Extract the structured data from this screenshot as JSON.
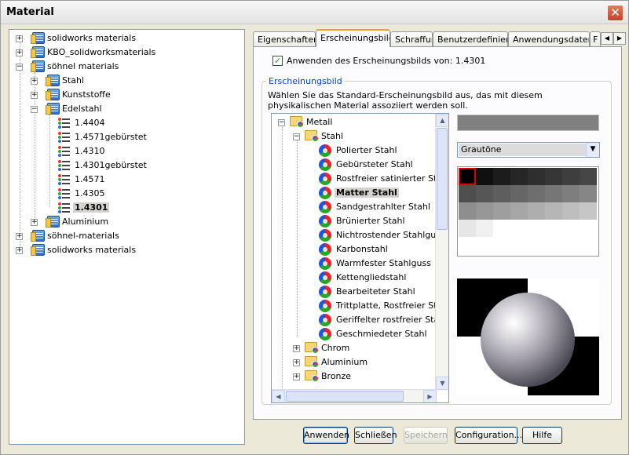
{
  "window": {
    "title": "Material",
    "close_glyph": "✕"
  },
  "material_tree": {
    "roots": [
      {
        "label": "solidworks materials",
        "expanded": false
      },
      {
        "label": "KBO_solidworksmaterials",
        "expanded": false
      },
      {
        "label": "söhnel materials",
        "expanded": true
      },
      {
        "label": "söhnel-materials",
        "expanded": false
      },
      {
        "label": "solidworks materials",
        "expanded": false
      }
    ],
    "sohnel_children": [
      "Stahl",
      "Kunststoffe",
      "Edelstahl",
      "Aluminium"
    ],
    "edelstahl_items": [
      "1.4404",
      "1.4571gebürstet",
      "1.4310",
      "1.4301gebürstet",
      "1.4571",
      "1.4305",
      "1.4301"
    ],
    "selected": "1.4301"
  },
  "tabs": [
    "Eigenschaften",
    "Erscheinungsbild",
    "Schraffur",
    "Benutzerdefiniert",
    "Anwendungsdaten",
    "F"
  ],
  "active_tab": "Erscheinungsbild",
  "appearance": {
    "apply_checkbox_label": "Anwenden des Erscheinungsbilds von: 1.4301",
    "apply_checked": true,
    "group_title": "Erscheinungsbild",
    "description": "Wählen Sie das Standard-Erscheinungsbild aus, das mit diesem physikalischen Material assoziiert werden soll.",
    "tree_root": "Metall",
    "tree_group": "Stahl",
    "stahl_items": [
      "Polierter Stahl",
      "Gebürsteter Stahl",
      "Rostfreier satinierter Stahl",
      "Matter Stahl",
      "Sandgestrahlter Stahl",
      "Brünierter Stahl",
      "Nichtrostender Stahlguß",
      "Karbonstahl",
      "Warmfester Stahlguss",
      "Kettengliedstahl",
      "Bearbeiteter Stahl",
      "Trittplatte, Rostfreier Stahl",
      "Geriffelter rostfreier Stahl",
      "Geschmiedeter Stahl"
    ],
    "selected_item": "Matter Stahl",
    "other_folders": [
      "Chrom",
      "Aluminium",
      "Bronze"
    ],
    "color_scheme": "Grautöne",
    "current_color": "#808080"
  },
  "buttons": {
    "apply": "Anwenden",
    "close": "Schließen",
    "save": "Speichern",
    "configuration": "Configuration...",
    "help": "Hilfe"
  },
  "colors": {
    "accent": "#0046d5",
    "selection_red": "#e00000"
  }
}
